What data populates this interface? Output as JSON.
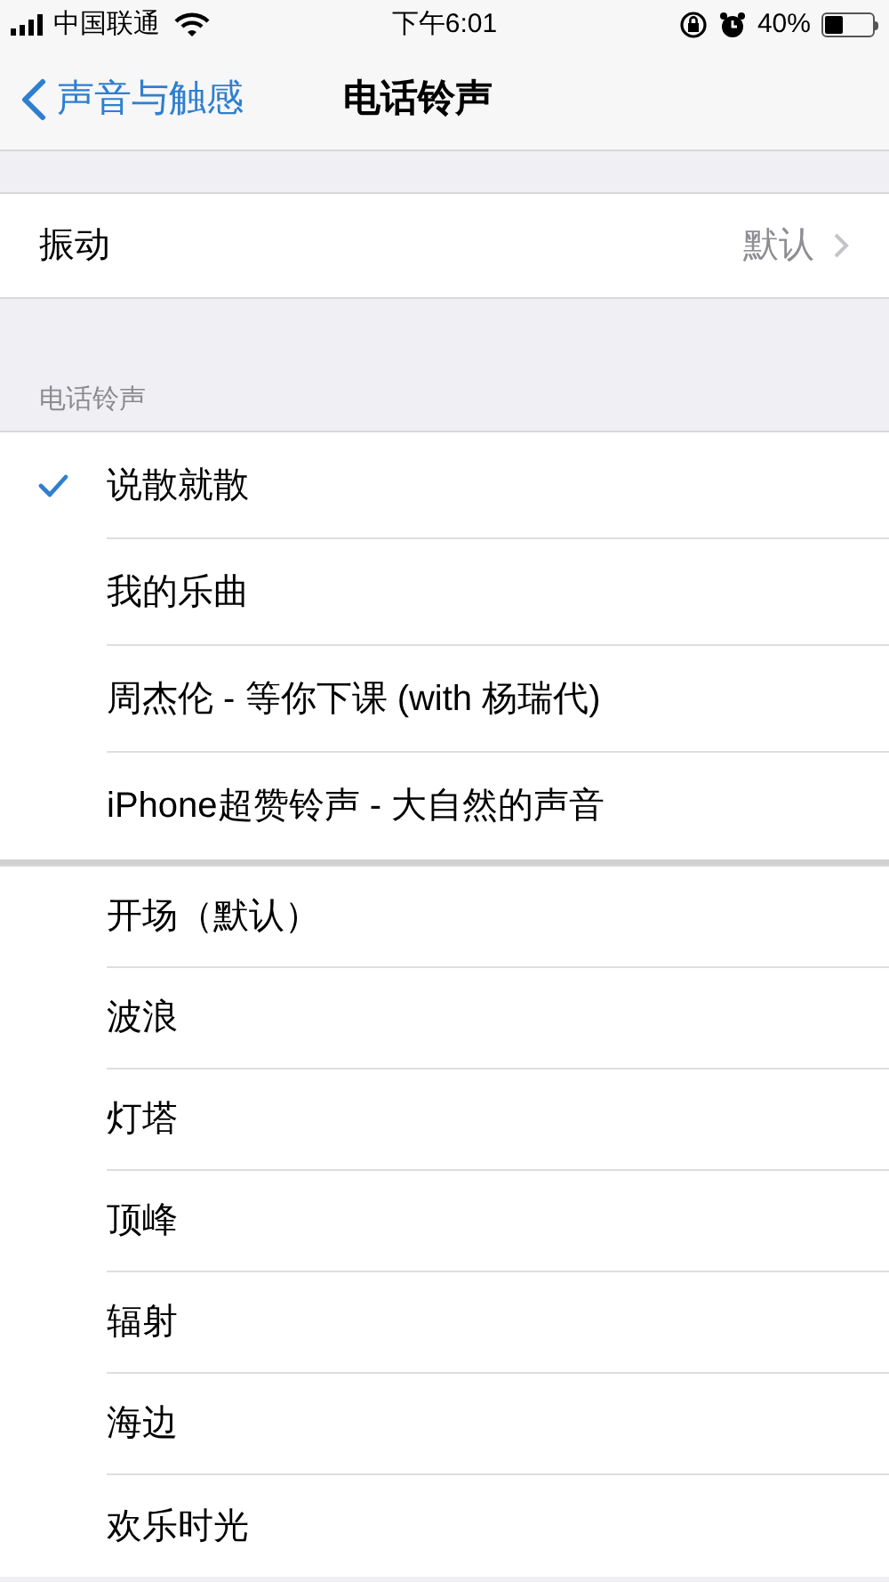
{
  "status_bar": {
    "carrier": "中国联通",
    "time": "下午6:01",
    "battery": "40%"
  },
  "nav": {
    "back": "声音与触感",
    "title": "电话铃声"
  },
  "vibration": {
    "label": "振动",
    "value": "默认"
  },
  "section_header": "电话铃声",
  "custom_ringtones": [
    {
      "name": "说散就散",
      "selected": true
    },
    {
      "name": "我的乐曲",
      "selected": false
    },
    {
      "name": "周杰伦 - 等你下课 (with 杨瑞代)",
      "selected": false
    },
    {
      "name": "iPhone超赞铃声 - 大自然的声音",
      "selected": false
    }
  ],
  "ringtones": [
    {
      "name": "开场（默认）",
      "selected": false
    },
    {
      "name": "波浪",
      "selected": false
    },
    {
      "name": "灯塔",
      "selected": false
    },
    {
      "name": "顶峰",
      "selected": false
    },
    {
      "name": "辐射",
      "selected": false
    },
    {
      "name": "海边",
      "selected": false
    },
    {
      "name": "欢乐时光",
      "selected": false
    }
  ]
}
